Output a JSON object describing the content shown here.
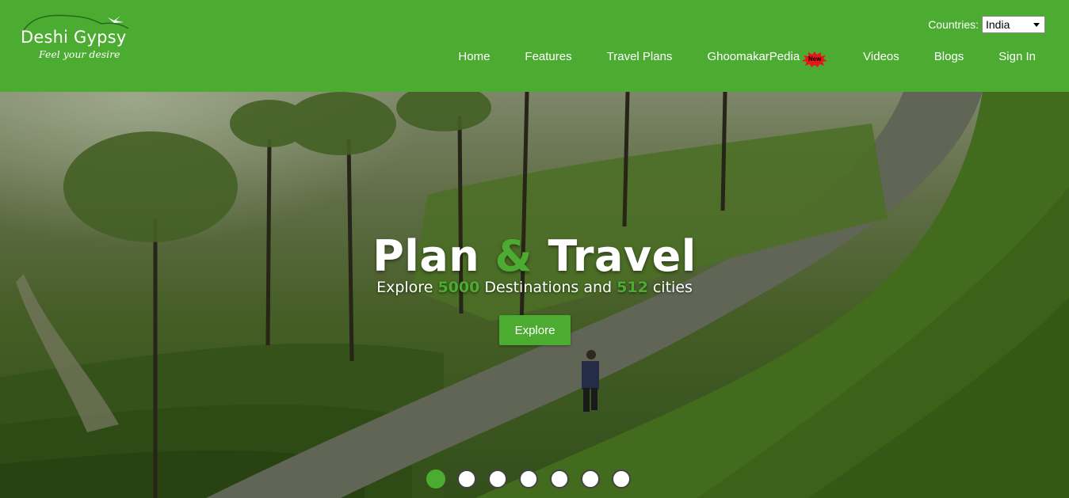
{
  "brand": {
    "name": "Deshi Gypsy",
    "tagline": "Feel your desire"
  },
  "country_selector": {
    "label": "Countries:",
    "selected": "India"
  },
  "nav": {
    "items": [
      "Home",
      "Features",
      "Travel Plans",
      "GhoomakarPedia",
      "Videos",
      "Blogs",
      "Sign In"
    ],
    "new_badge": "New"
  },
  "hero": {
    "title_part1": "Plan",
    "title_amp": "&",
    "title_part2": "Travel",
    "sub_prefix": "Explore",
    "destinations": "5000",
    "sub_middle": "Destinations and",
    "cities": "512",
    "sub_suffix": "cities",
    "cta_label": "Explore"
  },
  "carousel": {
    "slide_count": 7,
    "active_index": 0
  },
  "colors": {
    "brand_green": "#4cac32",
    "badge_red": "#e8151b"
  }
}
